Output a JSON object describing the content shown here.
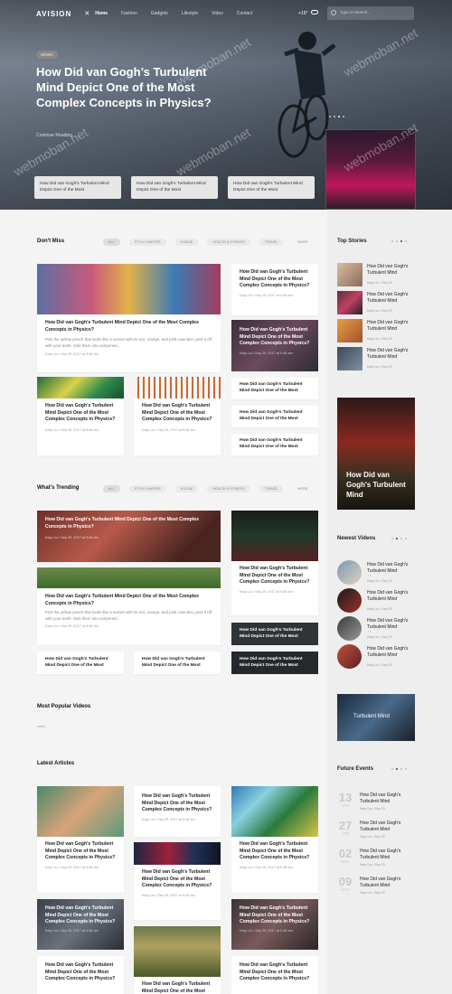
{
  "nav": {
    "logo": "AVISION",
    "items": [
      "Home",
      "Fashion",
      "Gadgets",
      "Lifestyle",
      "Video",
      "Contact"
    ],
    "temp": "+16°",
    "search_placeholder": "Type to Search..."
  },
  "hero": {
    "badge": "SPORT",
    "title": "How Did van Gogh’s Turbulent Mind Depict One of the Most Complex Concepts in Physics?",
    "continue": "Continue Reading",
    "cards": [
      "How Did van Gogh's Turbulent Mind Depict One of the Most",
      "How Did van Gogh's Turbulent Mind Depict One of the Most",
      "How Did van Gogh's Turbulent Mind Depict One of the Most"
    ]
  },
  "filters": [
    "ALL",
    "STYLE HUNTER",
    "VOGUE",
    "HEALTH & FITNESS",
    "TRAVEL",
    "MORE"
  ],
  "dontmiss": {
    "title": "Don't Miss",
    "main": {
      "title": "How Did van Gogh's Turbulent Mind Depict One of the Most Complex Concepts in Physics?",
      "excerpt": "Pick the yellow peach that looks like a sunset with its red, orange, and pink coat skin, peel it off with your teeth. Sink them into unripened...",
      "meta": "Katy Liu  •  Sep 29, 2017 at 9:48 am"
    },
    "right1": {
      "title": "How Did van Gogh's Turbulent Mind Depict One of the Most Complex Concepts in Physics?",
      "meta": "Katy Liu  •  Sep 29, 2017 at 9:48 am"
    },
    "right2": {
      "title": "How Did van Gogh's Turbulent Mind Depict One of the Most Complex Concepts in Physics?",
      "meta": "Katy Liu  •  Sep 29, 2017 at 9:48 am"
    },
    "small1": {
      "title": "How Did van Gogh's Turbulent Mind Depict One of the Most Complex Concepts in Physics?",
      "meta": "Katy Liu  •  Sep 29, 2017 at 9:48 am"
    },
    "small2": {
      "title": "How Did van Gogh's Turbulent Mind Depict One of the Most Complex Concepts in Physics?",
      "meta": "Katy Liu  •  Sep 29, 2017 at 9:48 am"
    },
    "list": [
      "How Did van Gogh's Turbulent Mind Depict One of the Most",
      "How Did van Gogh's Turbulent Mind Depict One of the Most",
      "How Did van Gogh's Turbulent Mind Depict One of the Most"
    ]
  },
  "trending": {
    "title": "What's Trending",
    "overlay": {
      "title": "How Did van Gogh's Turbulent Mind Depict One of the Most Complex Concepts in Physics?",
      "meta": "Katy Liu  •  Sep 29, 2017 at 9:48 am"
    },
    "main": {
      "title": "How Did van Gogh's Turbulent Mind Depict One of the Most Complex Concepts in Physics?",
      "excerpt": "Pick the yellow peach that looks like a sunset with its red, orange, and pink coat skin, peel it off with your teeth. Sink them into unripened...",
      "meta": "Katy Liu  •  Sep 29, 2017 at 9:48 am"
    },
    "right": {
      "title": "How Did van Gogh's Turbulent Mind Depict One of the Most Complex Concepts in Physics?",
      "meta": "Katy Liu  •  Sep 29, 2017 at 9:48 am"
    },
    "list": [
      "How Did van Gogh's Turbulent Mind Depict One of the Most",
      "How Did van Gogh's Turbulent Mind Depict One of the Most"
    ],
    "dark": [
      "How Did van Gogh's Turbulent Mind Depict One of the Most",
      "How Did van Gogh's Turbulent Mind Depict One of the Most"
    ]
  },
  "popular": {
    "title": "Most Popular Videos",
    "label": "video"
  },
  "latest": {
    "title": "Latest Articles",
    "card_title": "How Did van Gogh's Turbulent Mind Depict One of the Most Complex Concepts in Physics?",
    "meta": "Katy Liu  •  Sep 29, 2017 at 9:48 am"
  },
  "sidebar": {
    "top": {
      "title": "Top Stories",
      "items": [
        {
          "title": "How Did van Gogh's Turbulent Mind",
          "meta": "Katy Liu  •  Sep 29"
        },
        {
          "title": "How Did van Gogh's Turbulent Mind",
          "meta": "Katy Liu  •  Sep 29"
        },
        {
          "title": "How Did van Gogh's Turbulent Mind",
          "meta": "Katy Liu  •  Sep 29"
        },
        {
          "title": "How Did van Gogh's Turbulent Mind",
          "meta": "Katy Liu  •  Sep 29"
        }
      ]
    },
    "feature": "How Did van Gogh's Turbulent Mind",
    "videos": {
      "title": "Newest Videos",
      "items": [
        {
          "title": "How Did van Gogh's Turbulent Mind",
          "meta": "Katy Liu  •  Sep 29"
        },
        {
          "title": "How Did van Gogh's Turbulent Mind",
          "meta": "Katy Liu  •  Sep 29"
        },
        {
          "title": "How Did van Gogh's Turbulent Mind",
          "meta": "Katy Liu  •  Sep 29"
        },
        {
          "title": "How Did van Gogh's Turbulent Mind",
          "meta": "Katy Liu  •  Sep 29"
        }
      ]
    },
    "bottom_feature": "Turbulent Mind",
    "events": {
      "title": "Future Events",
      "items": [
        {
          "day": "13",
          "month": "APR",
          "title": "How Did van Gogh's Turbulent Mind",
          "meta": "Katy Liu  •  Sep 29"
        },
        {
          "day": "27",
          "month": "APR",
          "title": "How Did van Gogh's Turbulent Mind",
          "meta": "Katy Liu  •  Sep 29"
        },
        {
          "day": "02",
          "month": "MAY",
          "title": "How Did van Gogh's Turbulent Mind",
          "meta": "Katy Liu  •  Sep 29"
        },
        {
          "day": "09",
          "month": "MAY",
          "title": "How Did van Gogh's Turbulent Mind",
          "meta": "Katy Liu  •  Sep 29"
        }
      ]
    }
  },
  "watermark": "webmoban.net"
}
